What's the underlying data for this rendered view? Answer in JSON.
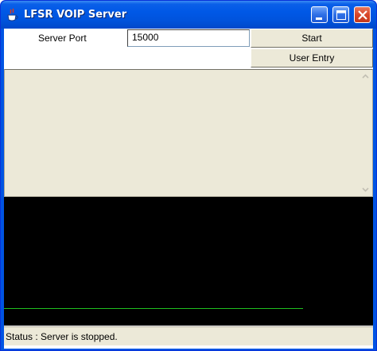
{
  "window": {
    "title": "LFSR VOIP Server",
    "minimize_icon": "minimize-icon",
    "maximize_icon": "maximize-icon",
    "close_icon": "close-icon",
    "app_icon": "java-cup-icon"
  },
  "form": {
    "port_label": "Server Port",
    "port_value": "15000",
    "start_label": "Start",
    "user_entry_label": "User Entry"
  },
  "log": {
    "text": ""
  },
  "status": {
    "text": "Status : Server is stopped."
  },
  "colors": {
    "titlebar": "#0058e6",
    "panel_bg": "#ece9d8",
    "waveform": "#1fbf1f",
    "visualizer_bg": "#000000"
  }
}
